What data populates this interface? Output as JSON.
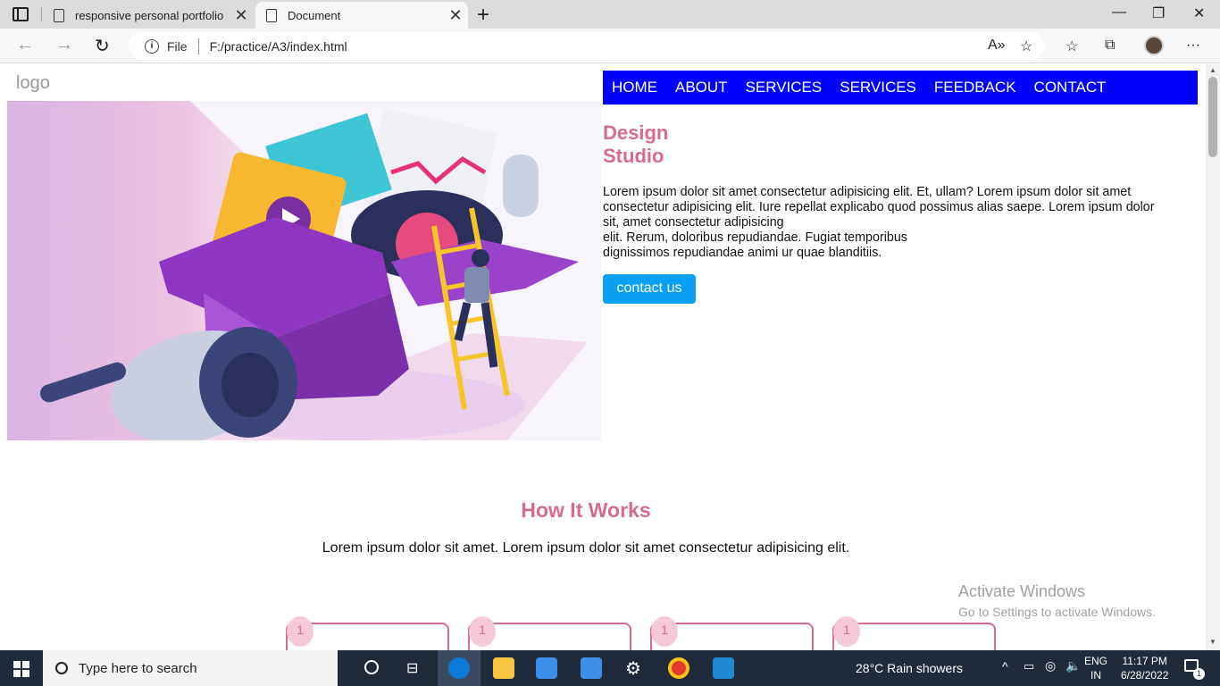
{
  "browser": {
    "tabs": [
      {
        "title": "responsive personal portfolio"
      },
      {
        "title": "Document"
      }
    ],
    "address": {
      "scheme_label": "File",
      "url": "F:/practice/A3/index.html"
    }
  },
  "page": {
    "logo": "logo",
    "nav": [
      "HOME",
      "ABOUT",
      "SERVICES",
      "SERVICES",
      "FEEDBACK",
      "CONTACT"
    ],
    "hero": {
      "title_lines": [
        "Design",
        "Studio"
      ],
      "paragraph_lines": [
        "Lorem ipsum dolor sit amet consectetur adipisicing elit. Et, ullam? Lorem ipsum dolor sit amet",
        "consectetur adipisicing elit. Iure repellat explicabo quod possimus alias saepe. Lorem ipsum dolor",
        "sit, amet consectetur adipisicing",
        "elit. Rerum, doloribus repudiandae. Fugiat temporibus",
        "dignissimos repudiandae animi ur quae blanditiis."
      ],
      "button": "contact us"
    },
    "how": {
      "title": "How It Works",
      "subtitle": "Lorem ipsum dolor sit amet. Lorem ipsum dolor sit amet consectetur adipisicing elit.",
      "steps": [
        "1",
        "1",
        "1",
        "1"
      ]
    }
  },
  "watermark": {
    "line1": "Activate Windows",
    "line2": "Go to Settings to activate Windows."
  },
  "taskbar": {
    "search_placeholder": "Type here to search",
    "weather": "28°C  Rain showers",
    "lang_top": "ENG",
    "lang_bottom": "IN",
    "time": "11:17 PM",
    "date": "6/28/2022",
    "notification_count": "1"
  },
  "colors": {
    "nav_bg": "#0000ff",
    "accent_pink": "#d66a93",
    "button_blue": "#0a9ff7"
  }
}
